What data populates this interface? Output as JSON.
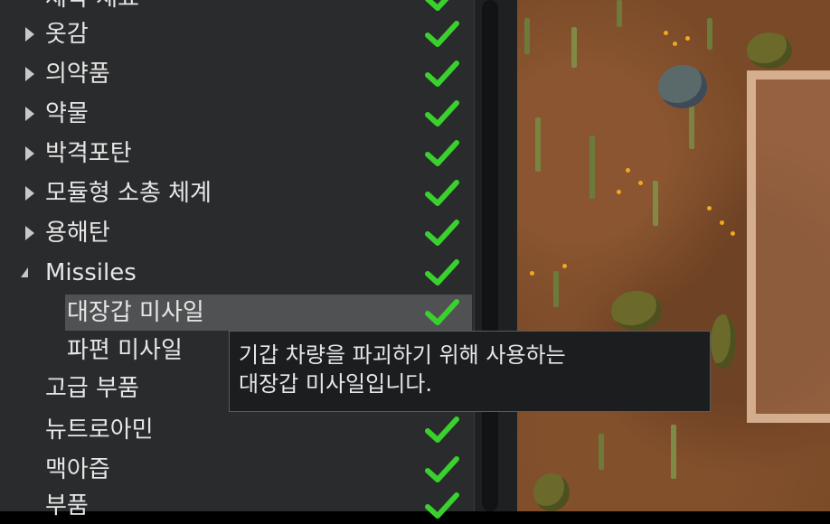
{
  "tree": {
    "top_partial_label": "제작 재료",
    "items": [
      {
        "label": "옷감",
        "expander": "closed",
        "checked": true
      },
      {
        "label": "의약품",
        "expander": "closed",
        "checked": true
      },
      {
        "label": "약물",
        "expander": "closed",
        "checked": true
      },
      {
        "label": "박격포탄",
        "expander": "closed",
        "checked": true
      },
      {
        "label": "모듈형 소총 체계",
        "expander": "closed",
        "checked": true
      },
      {
        "label": "용해탄",
        "expander": "closed",
        "checked": true
      },
      {
        "label": "Missiles",
        "expander": "open",
        "checked": true
      },
      {
        "label": "대장갑 미사일",
        "expander": "none",
        "checked": true,
        "highlighted": true
      },
      {
        "label": "파편 미사일",
        "expander": "none",
        "checked": false
      },
      {
        "label": "고급 부품",
        "expander": "none",
        "checked": false
      },
      {
        "label": "뉴트로아민",
        "expander": "none",
        "checked": true
      },
      {
        "label": "맥아즙",
        "expander": "none",
        "checked": true
      },
      {
        "label": "부품",
        "expander": "none",
        "checked": true
      }
    ]
  },
  "tooltip": {
    "line1": "기갑 차량을 파괴하기 위해 사용하는",
    "line2": "대장갑 미사일입니다."
  },
  "colors": {
    "check": "#3ad12f",
    "panel_bg": "#2a2b2c",
    "highlight_bg": "#505152",
    "tooltip_bg": "#1c1d1e"
  }
}
